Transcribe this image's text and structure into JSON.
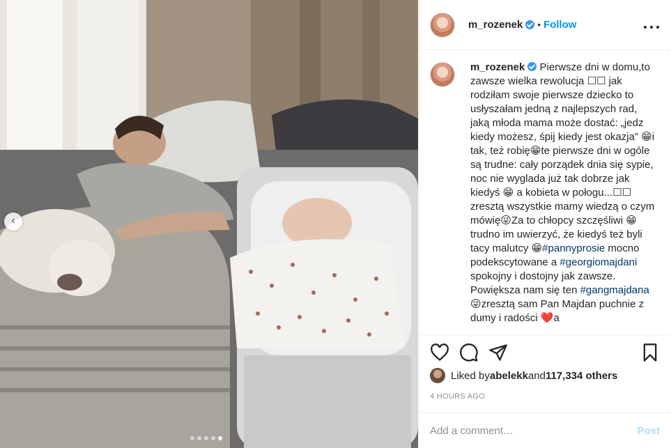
{
  "post": {
    "username": "m_rozenek",
    "follow_label": "Follow",
    "bullet": "•",
    "more_label": "• • •"
  },
  "caption": {
    "username": "m_rozenek",
    "text_1": " Pierwsze dni w domu,to zawsze wielka rewolucja ☐☐ jak rodziłam swoje pierwsze dziecko to usłyszałam jedną z najlepszych rad, jaką młoda mama może dostać: „jedz kiedy możesz, śpij kiedy jest okazja” 😁i tak, też robię😁te pierwsze dni w ogóle są trudne: cały porządek dnia się sypie, noc nie wyglada już tak dobrze jak kiedyś 😁 a kobieta w połogu...☐☐ zresztą wszystkie mamy wiedzą o czym mówię😜Za to chłopcy szczęśliwi 😁 trudno im uwierzyć, że kiedyś też byli tacy malutcy 😁",
    "hashtag_1": "#pannyprosie",
    "text_2": " mocno podekscytowane a ",
    "hashtag_2": "#georgiomajdani",
    "text_3": " spokojny i dostojny jak zawsze. Powiększa nam się ten ",
    "hashtag_3": "#gangmajdana",
    "text_4": " 😜zresztą sam Pan Majdan puchnie z dumy i radości ❤️a"
  },
  "likes": {
    "prefix": "Liked by ",
    "user": "abelekk",
    "middle": " and ",
    "count": "117,334 others"
  },
  "timestamp": "4 HOURS AGO",
  "comment": {
    "placeholder": "Add a comment…",
    "post_label": "Post"
  },
  "carousel": {
    "total": 5,
    "active_index": 4
  },
  "colors": {
    "accent": "#0095f6",
    "verified": "#3897f0",
    "hashtag": "#00376b",
    "muted": "#8e8e8e",
    "post_disabled": "#b3dbff"
  }
}
